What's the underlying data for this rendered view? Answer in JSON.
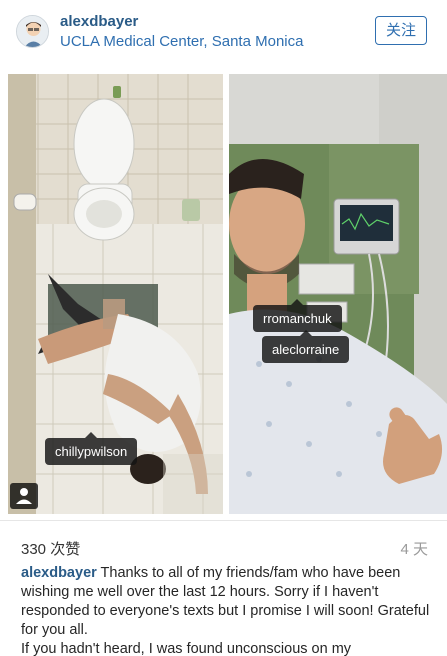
{
  "post": {
    "username": "alexdbayer",
    "location": "UCLA Medical Center, Santa Monica",
    "follow_label": "关注"
  },
  "tags": {
    "chilly": "chillypwilson",
    "rroman": "rromanchuk",
    "alec": "aleclorraine"
  },
  "meta": {
    "likes": "330 次赞",
    "time": "4 天"
  },
  "caption": {
    "username": "alexdbayer",
    "line1": " Thanks to all of my friends/fam who have been wishing me well over the last 12 hours. Sorry if I haven't responded to everyone's texts but I promise I will soon! Grateful for you all.",
    "line2": "If you hadn't heard, I was found unconscious on my"
  },
  "icons": {
    "avatar": "avatar-icon",
    "tagged_people": "tagged-people-icon"
  },
  "colors": {
    "link": "#2f6fb0",
    "username": "#2a5b87",
    "tag_bg": "#141414"
  }
}
